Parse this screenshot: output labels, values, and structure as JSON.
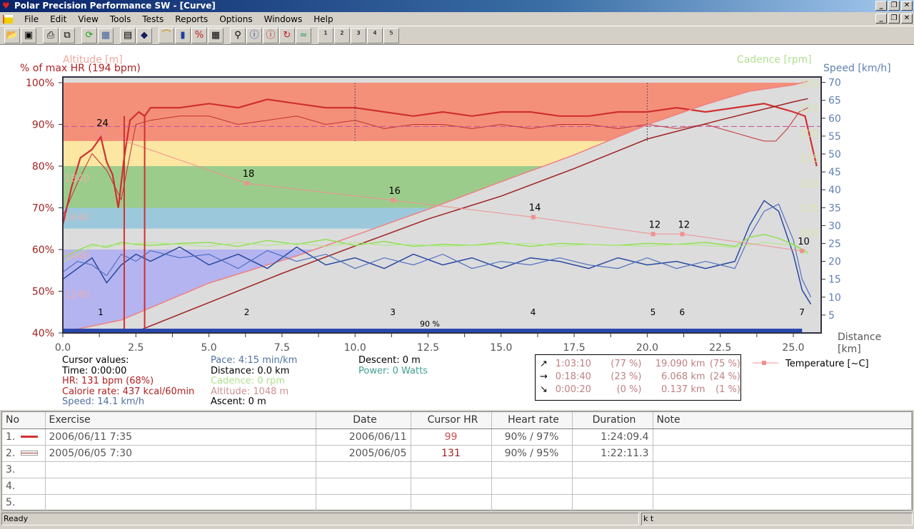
{
  "window": {
    "title": "Polar Precision Performance SW - [Curve]",
    "controls": [
      "_",
      "❐",
      "✕"
    ]
  },
  "menu": [
    "File",
    "Edit",
    "View",
    "Tools",
    "Tests",
    "Reports",
    "Options",
    "Windows",
    "Help"
  ],
  "toolbar": [
    {
      "icon": "open-folder-icon",
      "glyph": "📂"
    },
    {
      "icon": "save-icon",
      "glyph": "▣"
    },
    null,
    {
      "icon": "print-icon",
      "glyph": "⎙"
    },
    {
      "icon": "copy-icon",
      "glyph": "⧉"
    },
    null,
    {
      "icon": "refresh-icon",
      "glyph": "⟳",
      "color": "#20a020"
    },
    {
      "icon": "monitor-icon",
      "glyph": "▦",
      "color": "#4060a0"
    },
    null,
    {
      "icon": "calendar-icon",
      "glyph": "▤"
    },
    {
      "icon": "diary-book-icon",
      "glyph": "◆",
      "color": "#102060"
    },
    null,
    {
      "icon": "curve-icon",
      "glyph": "⌒",
      "color": "#c09000"
    },
    {
      "icon": "histogram-icon",
      "glyph": "▮",
      "color": "#2040a0"
    },
    {
      "icon": "zone-percent-icon",
      "glyph": "%",
      "color": "#c02020"
    },
    {
      "icon": "table-icon",
      "glyph": "▦"
    },
    null,
    {
      "icon": "zoom-icon",
      "glyph": "⚲"
    },
    {
      "icon": "info-curve-icon",
      "glyph": "ⓘ",
      "color": "#2040a0"
    },
    {
      "icon": "info-arrow-icon",
      "glyph": "ⓘ",
      "color": "#a02020"
    },
    {
      "icon": "recovery-icon",
      "glyph": "↻",
      "color": "#c02020"
    },
    {
      "icon": "compare-curves-icon",
      "glyph": "≈",
      "color": "#20a060"
    },
    null,
    {
      "icon": "bar-chart-1-icon",
      "glyph": "¹"
    },
    {
      "icon": "bar-chart-2-icon",
      "glyph": "²"
    },
    {
      "icon": "bar-chart-3-icon",
      "glyph": "³"
    },
    {
      "icon": "bar-chart-4-icon",
      "glyph": "⁴"
    },
    {
      "icon": "bar-chart-5-icon",
      "glyph": "⁵"
    }
  ],
  "chart_data": {
    "type": "line",
    "axes": {
      "left_title": "% of max HR (194 bpm)",
      "left_ticks": [
        "100%",
        "90%",
        "80%",
        "70%",
        "60%",
        "50%",
        "40%"
      ],
      "left_range": [
        40,
        100
      ],
      "altitude_title": "Altitude [m]",
      "altitude_ticks": [
        "1840",
        "1640",
        "1440",
        "1240"
      ],
      "cadence_title": "Cadence [rpm]",
      "cadence_ticks": [
        "250",
        "225",
        "200",
        "175",
        "150",
        "125",
        "100"
      ],
      "speed_title": "Speed [km/h]",
      "speed_ticks": [
        "70",
        "65",
        "60",
        "55",
        "50",
        "45",
        "40",
        "35",
        "30",
        "25",
        "20",
        "15",
        "10",
        "5"
      ],
      "speed_range": [
        0,
        70
      ],
      "x_title": "Distance",
      "x_unit": "[km]",
      "x_ticks": [
        "0.0",
        "2.5",
        "5.0",
        "7.5",
        "10.0",
        "12.5",
        "15.0",
        "17.5",
        "20.0",
        "22.5",
        "25.0"
      ],
      "x_range": [
        0,
        25.9
      ]
    },
    "hr_zones": [
      {
        "from": 86,
        "to": 100,
        "color": "#f4907a"
      },
      {
        "from": 80,
        "to": 86,
        "color": "#fbe6a2"
      },
      {
        "from": 70,
        "to": 80,
        "color": "#9ccc8c"
      },
      {
        "from": 65,
        "to": 70,
        "color": "#9cc8dc"
      },
      {
        "from": 60,
        "to": 65,
        "color": "#dcdcdc"
      },
      {
        "from": 40,
        "to": 60,
        "color": "#b4b4f0"
      }
    ],
    "zone_labels": {
      "limit_90": "90 %"
    },
    "series": [
      {
        "kind": "hr",
        "color": "#d03030",
        "width": 2.2,
        "x": [
          0,
          0.3,
          0.6,
          1,
          1.3,
          1.5,
          1.7,
          1.9,
          2.1,
          2.3,
          2.6,
          2.8,
          3,
          4,
          5,
          6,
          7,
          8,
          9,
          10,
          11,
          12,
          13,
          14,
          15,
          16,
          17,
          18,
          19,
          20,
          21,
          22,
          23,
          24,
          25,
          25.4,
          25.6,
          25.8
        ],
        "y": [
          66,
          75,
          82,
          84,
          87,
          81,
          78,
          70,
          82,
          91,
          93,
          92,
          94,
          94,
          95,
          94,
          96,
          95,
          94,
          94,
          93,
          92,
          93,
          92,
          93,
          93,
          92,
          92,
          93,
          93,
          94,
          93,
          94,
          95,
          93,
          92,
          86,
          80
        ]
      },
      {
        "kind": "hr",
        "color": "#c03030",
        "width": 1,
        "x": [
          0,
          0.5,
          1,
          1.5,
          2,
          2.5,
          3,
          4,
          5,
          6,
          7,
          8,
          9,
          10,
          11,
          12,
          13,
          14,
          15,
          16,
          17,
          18,
          19,
          20,
          21,
          22,
          23,
          23.5,
          24,
          24.4,
          24.8,
          25.2,
          25.5
        ],
        "y": [
          68,
          76,
          83,
          79,
          72,
          90,
          91,
          92,
          92,
          90,
          91,
          92,
          90,
          91,
          89,
          90,
          90,
          89,
          90,
          89,
          90,
          90,
          89,
          90,
          89,
          90,
          88,
          87,
          86,
          86,
          89,
          93,
          94
        ]
      },
      {
        "kind": "altitude",
        "color": "#f08080",
        "fill": "#d8d8d8",
        "x": [
          0,
          2,
          5,
          8,
          10,
          12.5,
          15,
          17.5,
          20,
          22,
          23.5,
          25,
          25.5
        ],
        "y": [
          1048,
          1110,
          1300,
          1440,
          1546,
          1680,
          1822,
          1960,
          2115,
          2220,
          2288,
          2320,
          2340
        ]
      },
      {
        "kind": "altitude",
        "color": "#a02020",
        "width": 1.5,
        "x": [
          2.5,
          5,
          7.5,
          10,
          12.5,
          15,
          17.5,
          20,
          22.5,
          25,
          25.5
        ],
        "y": [
          1050,
          1200,
          1350,
          1491,
          1630,
          1748,
          1890,
          2042,
          2140,
          2233,
          2250
        ]
      },
      {
        "kind": "speed",
        "color": "#2848a0",
        "width": 1.5,
        "x": [
          0,
          0.5,
          1,
          1.5,
          2,
          2.5,
          3,
          4,
          5,
          6,
          7,
          8,
          9,
          10,
          11,
          12,
          13,
          14,
          15,
          16,
          17,
          18,
          19,
          20,
          21,
          22,
          23,
          23.5,
          24,
          24.5,
          25,
          25.3,
          25.6
        ],
        "y": [
          15,
          18,
          21,
          14,
          19,
          22,
          20,
          24,
          19,
          22,
          18,
          24,
          19,
          21,
          18,
          22,
          19,
          21,
          18,
          21,
          20,
          18,
          21,
          19,
          20,
          18,
          20,
          30,
          37,
          34,
          22,
          12,
          8
        ]
      },
      {
        "kind": "speed",
        "color": "#5070c0",
        "width": 1.2,
        "x": [
          0,
          0.5,
          1,
          1.5,
          2,
          2.5,
          3,
          4,
          5,
          6,
          7,
          8,
          9,
          10,
          11,
          12,
          13,
          14,
          15,
          16,
          17,
          18,
          19,
          20,
          21,
          22,
          23,
          23.5,
          24,
          24.5,
          25,
          25.3,
          25.6
        ],
        "y": [
          17,
          20,
          19,
          16,
          22,
          20,
          23,
          21,
          22,
          18,
          23,
          20,
          22,
          18,
          21,
          19,
          22,
          18,
          20,
          19,
          21,
          19,
          18,
          21,
          18,
          20,
          18,
          27,
          34,
          36,
          26,
          15,
          10
        ]
      },
      {
        "kind": "cadence",
        "color": "#90e050",
        "width": 1.5,
        "x": [
          0,
          0.5,
          1,
          1.5,
          2,
          2.5,
          3,
          4,
          5,
          6,
          7,
          8,
          9,
          10,
          11,
          12,
          13,
          14,
          15,
          16,
          17,
          18,
          19,
          20,
          21,
          22,
          23,
          23.5,
          24,
          24.5,
          25,
          25.5
        ],
        "y": [
          75,
          82,
          88,
          85,
          90,
          88,
          87,
          89,
          90,
          86,
          92,
          88,
          93,
          87,
          91,
          86,
          88,
          87,
          90,
          86,
          89,
          88,
          87,
          89,
          88,
          90,
          86,
          95,
          98,
          94,
          88,
          80
        ]
      },
      {
        "kind": "cadence",
        "color": "#b0e880",
        "width": 1,
        "x": [
          0,
          1,
          2,
          3,
          4,
          5,
          6,
          7,
          8,
          9,
          10,
          11,
          12,
          13,
          14,
          15,
          16,
          17,
          18,
          19,
          20,
          21,
          22,
          23,
          24,
          25,
          25.5
        ],
        "y": [
          70,
          86,
          88,
          90,
          88,
          86,
          90,
          87,
          89,
          86,
          90,
          87,
          88,
          86,
          87,
          88,
          89,
          86,
          88,
          87,
          86,
          88,
          87,
          85,
          90,
          87,
          78
        ]
      },
      {
        "kind": "temperature",
        "color": "#f09090",
        "width": 1,
        "x": [
          1.3,
          6.3,
          11.3,
          16.1,
          20.2,
          21.2,
          25.3
        ],
        "y": [
          24,
          18,
          16,
          14,
          12,
          12,
          10
        ],
        "labels": [
          "24",
          "18",
          "16",
          "14",
          "12",
          "12",
          "10"
        ]
      }
    ],
    "lap_markers": {
      "x": [
        1.3,
        6.3,
        11.3,
        16.1,
        20.2,
        21.2,
        25.3
      ],
      "labels": [
        "1",
        "2",
        "3",
        "4",
        "5",
        "6",
        "7"
      ]
    },
    "legend": [
      {
        "label": "Temperature [~C]",
        "color": "#f09090"
      }
    ]
  },
  "cursor_values": {
    "title": "Cursor values:",
    "time": "Time: 0:00:00",
    "hr": "HR: 131 bpm (68%)",
    "calorie": "Calorie rate: 437 kcal/60min",
    "speed": "Speed: 14.1 km/h",
    "pace": "Pace: 4:15 min/km",
    "distance": "Distance: 0.0 km",
    "cadence": "Cadence: 0 rpm",
    "altitude": "Altitude: 1048 m",
    "ascent": "Ascent: 0 m",
    "descent": "Descent: 0 m",
    "power": "Power: 0 Watts",
    "colors": {
      "hr": "#b02020",
      "speed": "#5070a0",
      "cadence": "#b0e090",
      "altitude": "#d09090",
      "power": "#40a090"
    }
  },
  "summary": [
    {
      "arrow": "↗",
      "time": "1:03:10",
      "time_pct": "(77 %)",
      "dist": "19.090 km",
      "dist_pct": "(75 %)"
    },
    {
      "arrow": "→",
      "time": "0:18:40",
      "time_pct": "(23 %)",
      "dist": "6.068 km",
      "dist_pct": "(24 %)"
    },
    {
      "arrow": "↘",
      "time": "0:00:20",
      "time_pct": "(0 %)",
      "dist": "0.137 km",
      "dist_pct": "(1 %)"
    }
  ],
  "table": {
    "columns": [
      "No",
      "Exercise",
      "Date",
      "Cursor HR",
      "Heart rate",
      "Duration",
      "Note"
    ],
    "rows": [
      {
        "no": "1.",
        "exercise": "2006/06/11 7:35",
        "date": "2006/06/11",
        "cursor_hr": "99",
        "hr": "90% / 97%",
        "duration": "1:24:09.4",
        "note": "",
        "line": "solid"
      },
      {
        "no": "2.",
        "exercise": "2005/06/05 7:30",
        "date": "2005/06/05",
        "cursor_hr": "131",
        "hr": "90% / 95%",
        "duration": "1:22:11.3",
        "note": "",
        "line": "outline"
      },
      {
        "no": "3.",
        "exercise": "",
        "date": "",
        "cursor_hr": "",
        "hr": "",
        "duration": "",
        "note": ""
      },
      {
        "no": "4.",
        "exercise": "",
        "date": "",
        "cursor_hr": "",
        "hr": "",
        "duration": "",
        "note": ""
      },
      {
        "no": "5.",
        "exercise": "",
        "date": "",
        "cursor_hr": "",
        "hr": "",
        "duration": "",
        "note": ""
      }
    ]
  },
  "status": {
    "left": "Ready",
    "right": "k t"
  }
}
